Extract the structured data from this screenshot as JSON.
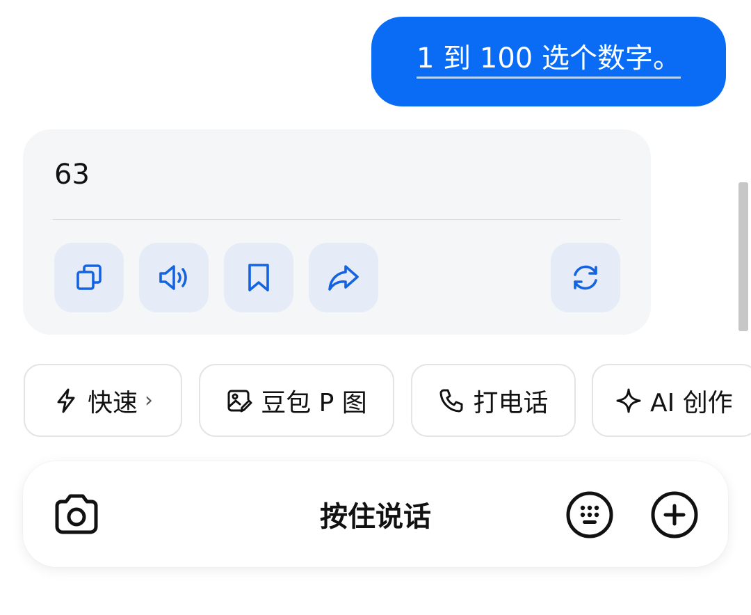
{
  "conversation": {
    "user_message": "1 到 100 选个数字。",
    "answer": "63"
  },
  "answer_actions": [
    {
      "name": "copy-button",
      "icon": "copy-icon"
    },
    {
      "name": "read-aloud-button",
      "icon": "speaker-icon"
    },
    {
      "name": "bookmark-button",
      "icon": "bookmark-icon"
    },
    {
      "name": "share-button",
      "icon": "share-icon"
    },
    {
      "name": "regenerate-button",
      "icon": "refresh-icon"
    }
  ],
  "chips": {
    "fast": {
      "label": "快速",
      "icon": "lightning-icon",
      "chevron": "›"
    },
    "photo_edit": {
      "label": "豆包 P 图",
      "icon": "image-edit-icon"
    },
    "call": {
      "label": "打电话",
      "icon": "phone-icon"
    },
    "ai_create": {
      "label": "AI 创作",
      "icon": "sparkle-icon"
    }
  },
  "input_bar": {
    "hold_to_talk": "按住说话",
    "left_icon": "camera-icon",
    "right_icons": [
      "keyboard-icon",
      "plus-icon"
    ]
  },
  "colors": {
    "accent": "#0a6cf5",
    "card_bg": "#f5f6f8",
    "action_bg": "#e5ecf7",
    "icon_blue": "#1463e0"
  }
}
